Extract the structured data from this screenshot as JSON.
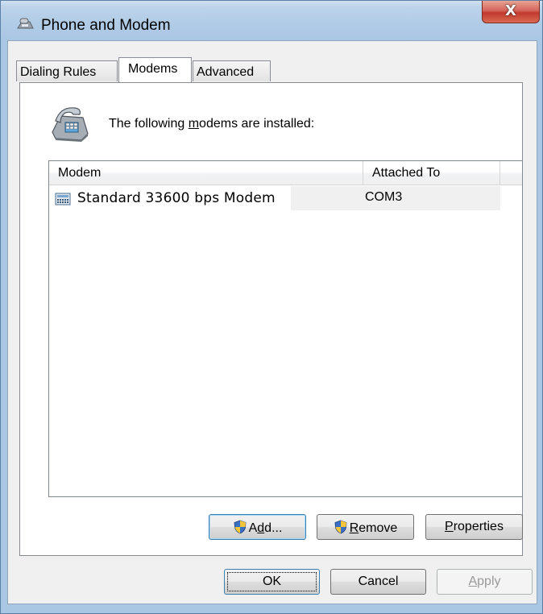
{
  "window": {
    "title": "Phone and Modem",
    "close_glyph": "X"
  },
  "tabs": [
    {
      "label": "Dialing Rules",
      "active": false
    },
    {
      "label": "Modems",
      "active": true
    },
    {
      "label": "Advanced",
      "active": false
    }
  ],
  "modems_tab": {
    "intro_prefix": "The following ",
    "intro_accel": "m",
    "intro_suffix": "odems are installed:",
    "columns": [
      "Modem",
      "Attached To"
    ],
    "rows": [
      {
        "modem": "Standard 33600 bps Modem",
        "attached_to": "COM3",
        "icon": "modem-icon"
      }
    ],
    "buttons": {
      "add": {
        "pre": "A",
        "accel": "d",
        "post": "d...",
        "icon": "uac-shield-icon"
      },
      "remove": {
        "pre": "",
        "accel": "R",
        "post": "emove",
        "icon": "uac-shield-icon"
      },
      "properties": {
        "pre": "",
        "accel": "P",
        "post": "roperties"
      }
    }
  },
  "dialog_buttons": {
    "ok": "OK",
    "cancel": "Cancel",
    "apply": {
      "pre": "",
      "accel": "A",
      "post": "pply",
      "disabled": true
    }
  },
  "icons": {
    "title": "phone-modem-icon",
    "header": "telephone-icon"
  },
  "colors": {
    "title_bar": "#b0cbe6",
    "close_button": "#c8463a",
    "focus_border": "#3c7fb1"
  }
}
